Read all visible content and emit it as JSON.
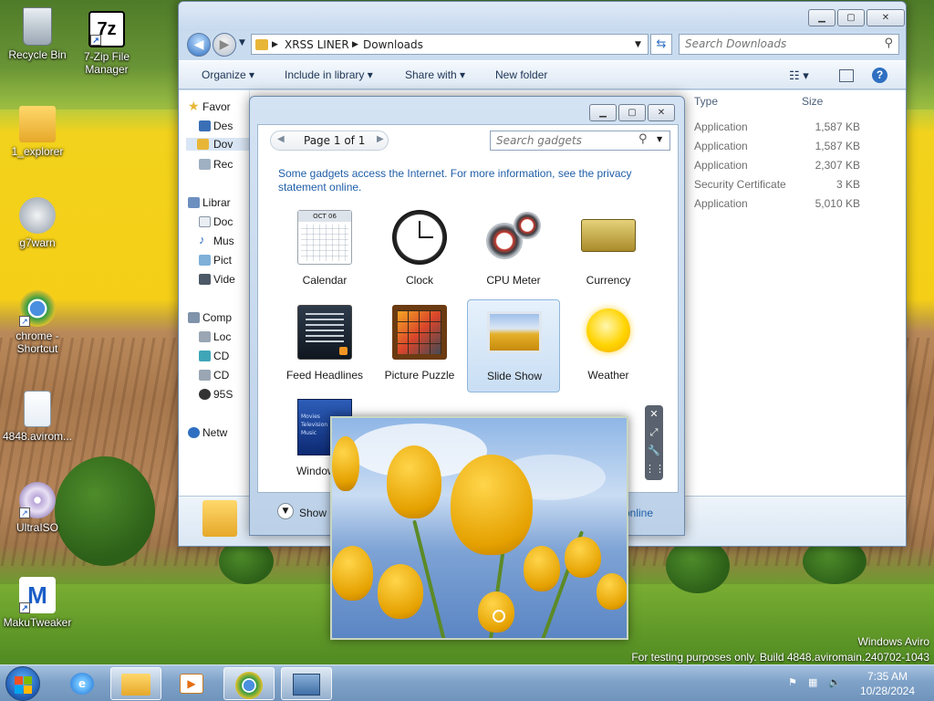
{
  "desktop": {
    "icons": [
      {
        "label": "Recycle Bin"
      },
      {
        "label": "7-Zip File Manager"
      },
      {
        "label": "1_explorer"
      },
      {
        "label": "g7warn"
      },
      {
        "label": "chrome - Shortcut"
      },
      {
        "label": "4848.avirom..."
      },
      {
        "label": "UltraISO"
      },
      {
        "label": "MakuTweaker"
      }
    ]
  },
  "explorer": {
    "breadcrumb": [
      "XRSS LINER",
      "Downloads"
    ],
    "search_placeholder": "Search Downloads",
    "toolbar": {
      "organize": "Organize",
      "include": "Include in library",
      "share": "Share with",
      "new_folder": "New folder"
    },
    "nav": {
      "favorites": "Favor",
      "desktop": "Des",
      "downloads": "Dov",
      "recent": "Rec",
      "libraries": "Librar",
      "documents": "Doc",
      "music": "Mus",
      "pictures": "Pict",
      "videos": "Vide",
      "computer": "Comp",
      "local": "Loc",
      "cd1": "CD",
      "cd2": "CD",
      "drive95": "95S",
      "network": "Netw"
    },
    "columns": {
      "type": "Type",
      "size": "Size"
    },
    "files": [
      {
        "type": "Application",
        "size": "1,587 KB"
      },
      {
        "type": "Application",
        "size": "1,587 KB"
      },
      {
        "type": "Application",
        "size": "2,307 KB"
      },
      {
        "type": "Security Certificate",
        "size": "3 KB"
      },
      {
        "type": "Application",
        "size": "5,010 KB"
      }
    ]
  },
  "gallery": {
    "pager_label": "Page 1 of 1",
    "search_placeholder": "Search gadgets",
    "info_text": "Some gadgets access the Internet.  For more information, see the privacy statement online.",
    "gadgets": [
      {
        "name": "Calendar"
      },
      {
        "name": "Clock"
      },
      {
        "name": "CPU Meter"
      },
      {
        "name": "Currency"
      },
      {
        "name": "Feed Headlines"
      },
      {
        "name": "Picture Puzzle"
      },
      {
        "name": "Slide Show"
      },
      {
        "name": "Weather"
      },
      {
        "name": "Windows M"
      }
    ],
    "calendar_month": "OCT 06",
    "show_details": "Show d",
    "get_more": "online",
    "mini_text": [
      "Movies",
      "Television",
      "Music"
    ]
  },
  "watermark": {
    "line1": "Windows Aviro",
    "line2": "For testing purposes only. Build 4848.aviromain.240702-1043"
  },
  "taskbar": {
    "time": "7:35 AM",
    "date": "10/28/2024"
  },
  "colors": {
    "accent_link": "#1f5ea8",
    "selection": "#c9def4",
    "taskbar": "#7fa2c8"
  }
}
